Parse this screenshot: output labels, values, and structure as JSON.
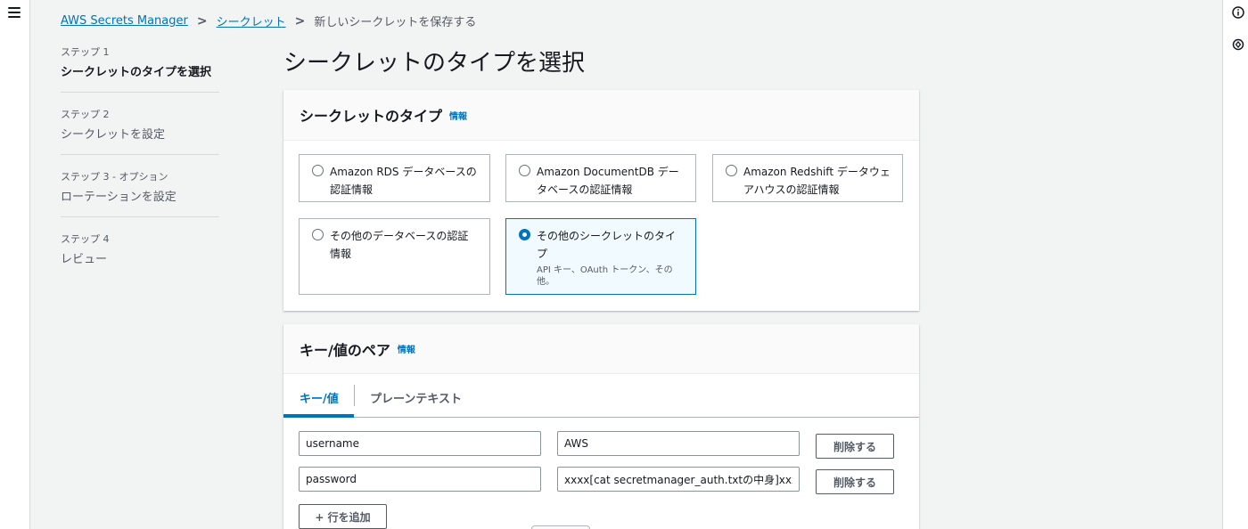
{
  "breadcrumb": {
    "items": [
      "AWS Secrets Manager",
      "シークレット"
    ],
    "current": "新しいシークレットを保存する"
  },
  "steps": [
    {
      "number": "ステップ 1",
      "title": "シークレットのタイプを選択",
      "active": true
    },
    {
      "number": "ステップ 2",
      "title": "シークレットを設定",
      "active": false
    },
    {
      "number": "ステップ 3 - オプション",
      "title": "ローテーションを設定",
      "active": false
    },
    {
      "number": "ステップ 4",
      "title": "レビュー",
      "active": false
    }
  ],
  "page_title": "シークレットのタイプを選択",
  "secret_type_panel": {
    "heading": "シークレットのタイプ",
    "info_label": "情報",
    "options": [
      {
        "label": "Amazon RDS データベースの認証情報",
        "selected": false
      },
      {
        "label": "Amazon DocumentDB データベースの認証情報",
        "selected": false
      },
      {
        "label": "Amazon Redshift データウェアハウスの認証情報",
        "selected": false
      },
      {
        "label": "その他のデータベースの認証情報",
        "selected": false
      },
      {
        "label": "その他のシークレットのタイプ",
        "description": "API キー、OAuth トークン、その他。",
        "selected": true
      }
    ]
  },
  "kv_panel": {
    "heading": "キー/値のペア",
    "info_label": "情報",
    "tabs": [
      {
        "label": "キー/値",
        "active": true
      },
      {
        "label": "プレーンテキスト",
        "active": false
      }
    ],
    "rows": [
      {
        "key": "username",
        "value": "AWS",
        "remove_label": "削除する"
      },
      {
        "key": "password",
        "value": "xxxx[cat secretmanager_auth.txtの中身]xxxxx",
        "remove_label": "削除する"
      }
    ],
    "add_row_label": "+ 行を追加"
  },
  "colors": {
    "accent": "#0073bb",
    "text": "#16191f",
    "muted": "#545b64",
    "background": "#f2f3f3"
  },
  "icons": {
    "menu": "hamburger-menu-icon",
    "info": "info-circle-icon",
    "right_rail_second": "settings-icon"
  }
}
